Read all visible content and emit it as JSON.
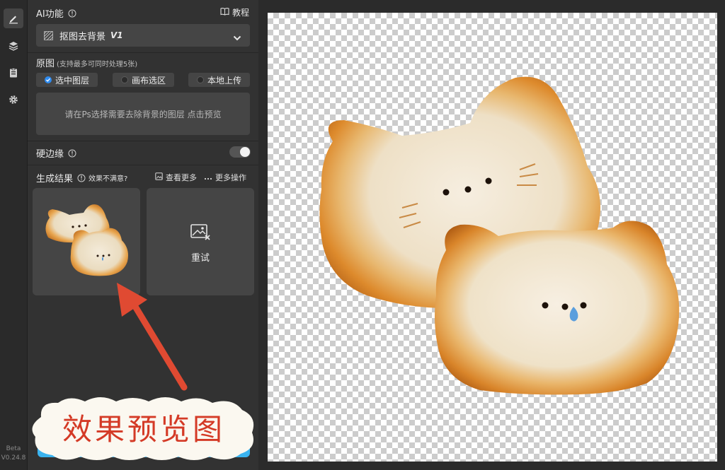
{
  "rail": {
    "items": [
      {
        "icon": "brush-icon",
        "active": true
      },
      {
        "icon": "layers-icon",
        "active": false
      },
      {
        "icon": "clipboard-icon",
        "active": false
      },
      {
        "icon": "gear-icon",
        "active": false
      }
    ],
    "beta_label": "Beta",
    "version": "V0.24.8"
  },
  "panel": {
    "ai_title": "AI功能",
    "tutorial_label": "教程",
    "model_label": "抠图去背景",
    "model_version": "V1",
    "source": {
      "title": "原图",
      "subtitle": "(支持最多可同时处理5张)",
      "options": [
        {
          "label": "选中图层",
          "selected": true
        },
        {
          "label": "画布选区",
          "selected": false
        },
        {
          "label": "本地上传",
          "selected": false
        }
      ],
      "hint": "请在Ps选择需要去除背景的图层 点击预览"
    },
    "hard_edge": {
      "label": "硬边缘",
      "enabled": false
    },
    "results": {
      "title": "生成结果",
      "feedback_label": "效果不满意?",
      "view_more_label": "查看更多",
      "more_actions_label": "更多操作",
      "retry_label": "重试"
    }
  },
  "annotation": {
    "caption": "效果预览图",
    "arrow_color": "#e04a32",
    "caption_color": "#d43a26"
  },
  "colors": {
    "accent": "#2f8cf0",
    "panel_bg": "#323232",
    "control_bg": "#454545"
  }
}
